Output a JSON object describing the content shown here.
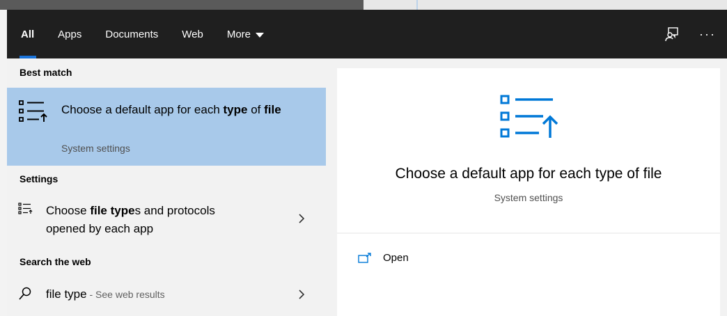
{
  "header": {
    "tabs": [
      {
        "label": "All",
        "active": true
      },
      {
        "label": "Apps"
      },
      {
        "label": "Documents"
      },
      {
        "label": "Web"
      },
      {
        "label": "More"
      }
    ],
    "icons": [
      "feedback-icon",
      "more-options-icon"
    ],
    "more_options_label": "···"
  },
  "best_match": {
    "header": "Best match",
    "title_part1": "Choose a default app for each ",
    "title_bold1": "type",
    "title_part2": " of ",
    "title_bold2": "file",
    "subtitle": "System settings",
    "icon": "default-apps-list-icon"
  },
  "settings": {
    "header": "Settings",
    "item": {
      "part1": "Choose ",
      "bold": "file type",
      "part2": "s and protocols",
      "line2": "opened by each app",
      "icon": "default-apps-list-icon"
    }
  },
  "web": {
    "header": "Search the web",
    "query": "file type",
    "suffix": " - See web results",
    "icon": "search-icon"
  },
  "preview": {
    "title": "Choose a default app for each type of file",
    "subtitle": "System settings",
    "icon": "default-apps-list-icon",
    "actions": [
      {
        "label": "Open",
        "icon": "open-icon"
      }
    ]
  },
  "colors": {
    "header_bg": "#1f1f1f",
    "accent": "#0078d7",
    "selected_bg": "#a8c9ea",
    "panel_bg": "#f2f2f2"
  }
}
